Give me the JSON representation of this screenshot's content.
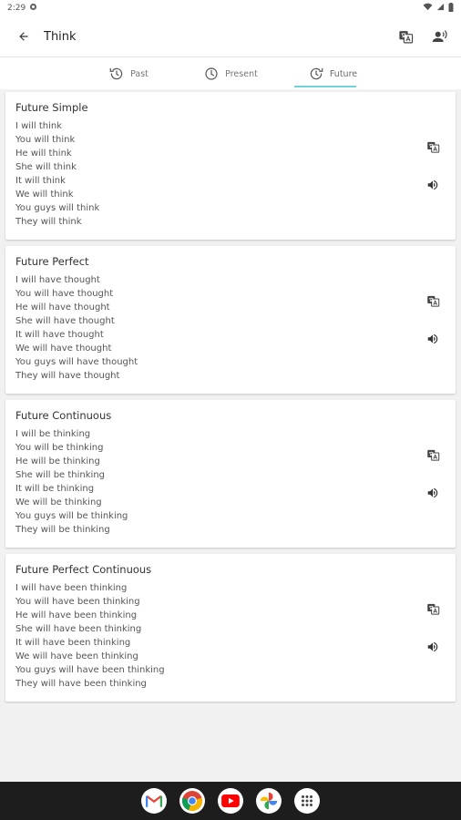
{
  "status": {
    "time": "2:29"
  },
  "app_bar": {
    "title": "Think"
  },
  "tabs": [
    {
      "label": "Past"
    },
    {
      "label": "Present"
    },
    {
      "label": "Future"
    }
  ],
  "active_tab": "Future",
  "accent_color": "#6fd3dc",
  "icons": {
    "back": "arrow-back-icon",
    "translate": "translate-icon",
    "voice": "record-voice-icon",
    "speaker": "volume-icon"
  },
  "cards": [
    {
      "title": "Future Simple",
      "lines": [
        "I will think",
        "You will think",
        "He will think",
        "She will think",
        "It will think",
        "We will think",
        "You guys will think",
        "They will think"
      ]
    },
    {
      "title": "Future Perfect",
      "lines": [
        "I will have thought",
        "You will have thought",
        "He will have thought",
        "She will have thought",
        "It will have thought",
        "We will have thought",
        "You guys will have thought",
        "They will have thought"
      ]
    },
    {
      "title": "Future Continuous",
      "lines": [
        "I will be thinking",
        "You will be thinking",
        "He will be thinking",
        "She will be thinking",
        "It will be thinking",
        "We will be thinking",
        "You guys will be thinking",
        "They will be thinking"
      ]
    },
    {
      "title": "Future Perfect Continuous",
      "lines": [
        "I will have been thinking",
        "You will have been thinking",
        "He will have been thinking",
        "She will have been thinking",
        "It will have been thinking",
        "We will have been thinking",
        "You guys will have been thinking",
        "They will have been thinking"
      ]
    }
  ],
  "dock": [
    "gmail-icon",
    "chrome-icon",
    "youtube-icon",
    "photos-icon",
    "app-drawer-icon"
  ]
}
